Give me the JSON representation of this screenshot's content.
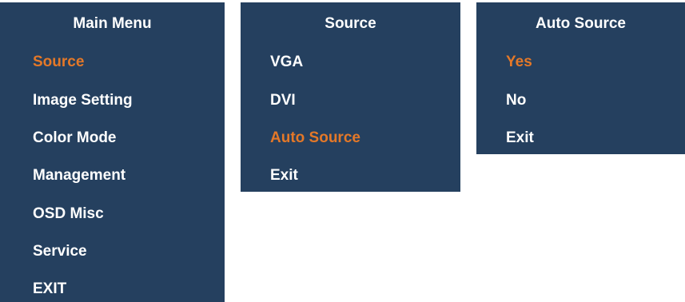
{
  "colors": {
    "panel_background": "#25405f",
    "text": "#ffffff",
    "highlight": "#e47828"
  },
  "main_menu": {
    "title": "Main Menu",
    "items": [
      "Source",
      "Image Setting",
      "Color Mode",
      "Management",
      "OSD Misc",
      "Service",
      "EXIT"
    ],
    "selected": "Source"
  },
  "source_menu": {
    "title": "Source",
    "items": [
      "VGA",
      "DVI",
      "Auto Source",
      "Exit"
    ],
    "selected": "Auto Source"
  },
  "auto_source_menu": {
    "title": "Auto Source",
    "items": [
      "Yes",
      "No",
      "Exit"
    ],
    "selected": "Yes"
  }
}
